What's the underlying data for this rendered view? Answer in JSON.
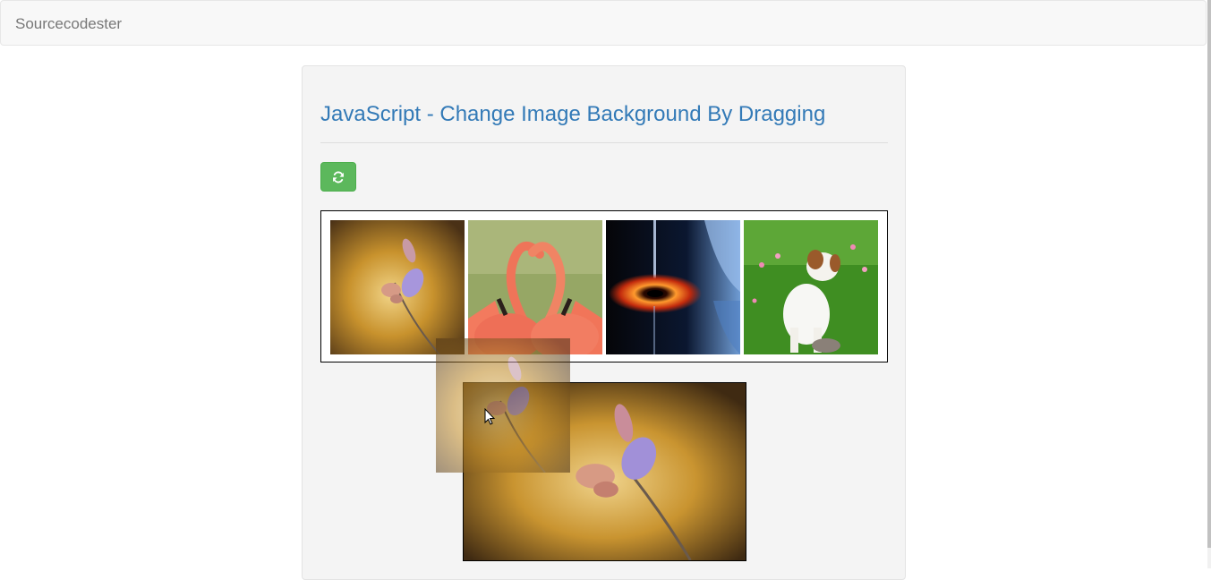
{
  "navbar": {
    "brand": "Sourcecodester"
  },
  "main": {
    "title": "JavaScript - Change Image Background By Dragging",
    "refresh_icon": "refresh-icon",
    "refresh_color": "#5cb85c",
    "title_color": "#337ab7"
  },
  "gallery": {
    "images": [
      {
        "subject": "butterfly"
      },
      {
        "subject": "flamingos"
      },
      {
        "subject": "black-hole"
      },
      {
        "subject": "puppy"
      }
    ]
  },
  "preview": {
    "subject": "butterfly"
  },
  "drag_ghost": {
    "subject": "butterfly"
  }
}
